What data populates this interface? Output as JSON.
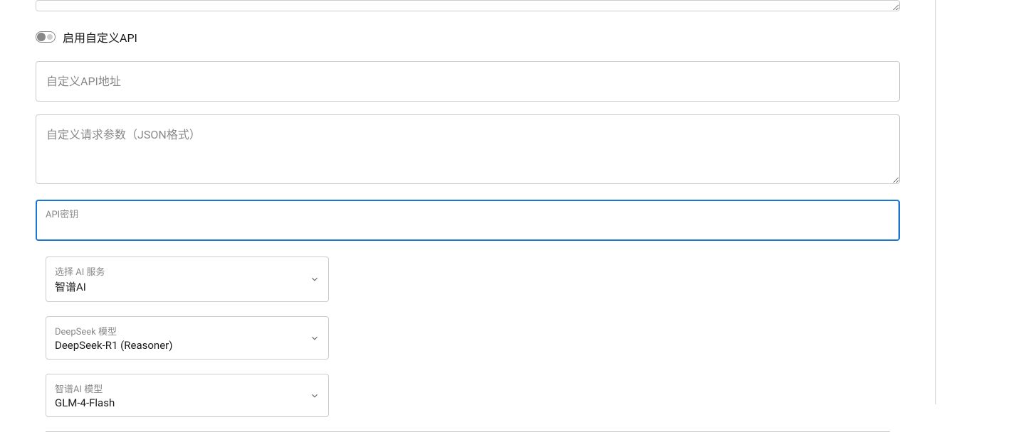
{
  "toggle": {
    "label": "启用自定义API"
  },
  "customApiUrl": {
    "placeholder": "自定义API地址",
    "value": ""
  },
  "customRequestParams": {
    "placeholder": "自定义请求参数（JSON格式）",
    "value": ""
  },
  "apiKey": {
    "label": "API密钥",
    "value": ""
  },
  "selects": {
    "aiService": {
      "label": "选择 AI 服务",
      "value": "智谱AI"
    },
    "deepseekModel": {
      "label": "DeepSeek 模型",
      "value": "DeepSeek-R1 (Reasoner)"
    },
    "zhipuModel": {
      "label": "智谱AI 模型",
      "value": "GLM-4-Flash"
    }
  }
}
